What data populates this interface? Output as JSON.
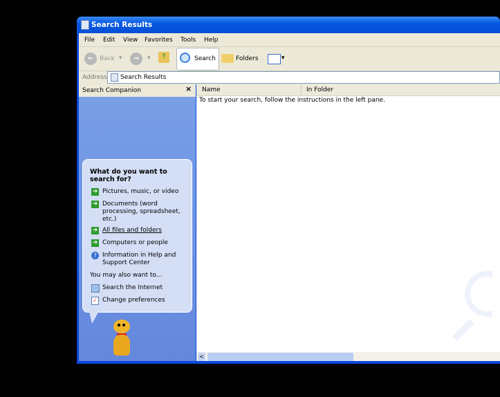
{
  "window": {
    "title": "Search Results",
    "icon": "search-results-icon"
  },
  "menu": [
    "File",
    "Edit",
    "View",
    "Favorites",
    "Tools",
    "Help"
  ],
  "toolbar": {
    "back": "Back",
    "search": "Search",
    "folders": "Folders"
  },
  "address": {
    "label": "Address",
    "value": "Search Results"
  },
  "companion": {
    "title": "Search Companion",
    "close": "×",
    "question": "What do you want to search for?",
    "items": [
      "Pictures, music, or video",
      "Documents (word processing, spreadsheet, etc.)",
      "All files and folders",
      "Computers or people",
      "Information in Help and Support Center"
    ],
    "also": "You may also want to...",
    "also_items": [
      "Search the Internet",
      "Change preferences"
    ]
  },
  "columns": [
    "Name",
    "In Folder"
  ],
  "results": {
    "message": "To start your search, follow the instructions in the left pane."
  },
  "colors": {
    "titlebar": "#0758e0",
    "pane": "#6f95e4",
    "bubble": "#d4def5"
  }
}
